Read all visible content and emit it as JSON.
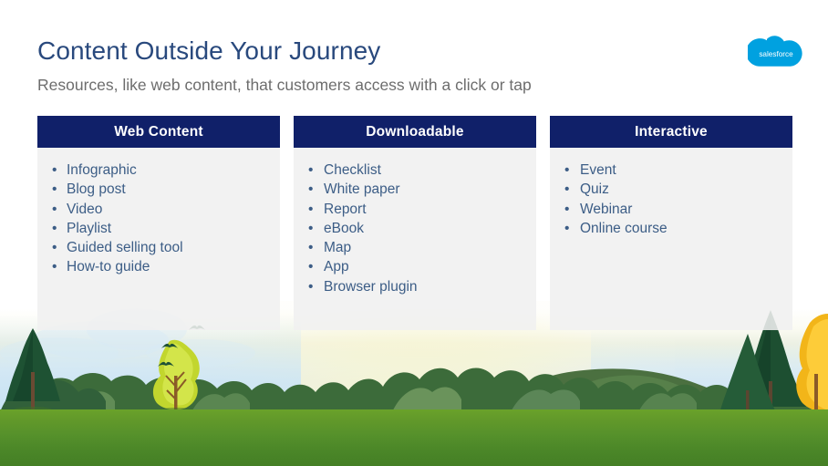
{
  "slide": {
    "title": "Content Outside Your Journey",
    "subtitle": "Resources, like web content, that customers access with a click or tap",
    "brand_logo_text": "salesforce",
    "colors": {
      "title": "#29497d",
      "subtitle": "#6d6d6d",
      "card_header_bg": "#102069",
      "card_header_text": "#ffffff",
      "card_body_bg": "#f0f0f0",
      "list_text": "#3c5d86",
      "brand_cloud": "#1eaee5",
      "grass": "#5a9329",
      "sky": "#d9e8f4"
    }
  },
  "columns": [
    {
      "header": "Web Content",
      "items": [
        "Infographic",
        "Blog post",
        "Video",
        "Playlist",
        "Guided selling tool",
        "How-to guide"
      ]
    },
    {
      "header": "Downloadable",
      "items": [
        "Checklist",
        "White paper",
        "Report",
        "eBook",
        "Map",
        "App",
        "Browser plugin"
      ]
    },
    {
      "header": "Interactive",
      "items": [
        "Event",
        "Quiz",
        "Webinar",
        "Online course"
      ]
    }
  ],
  "illustration": {
    "name": "nature-landscape",
    "elements": [
      "sky",
      "clouds",
      "birds",
      "rolling-hills",
      "pine-trees",
      "autumn-tree",
      "grass-field"
    ],
    "bird_count": 3
  },
  "bullet_glyph": "•"
}
